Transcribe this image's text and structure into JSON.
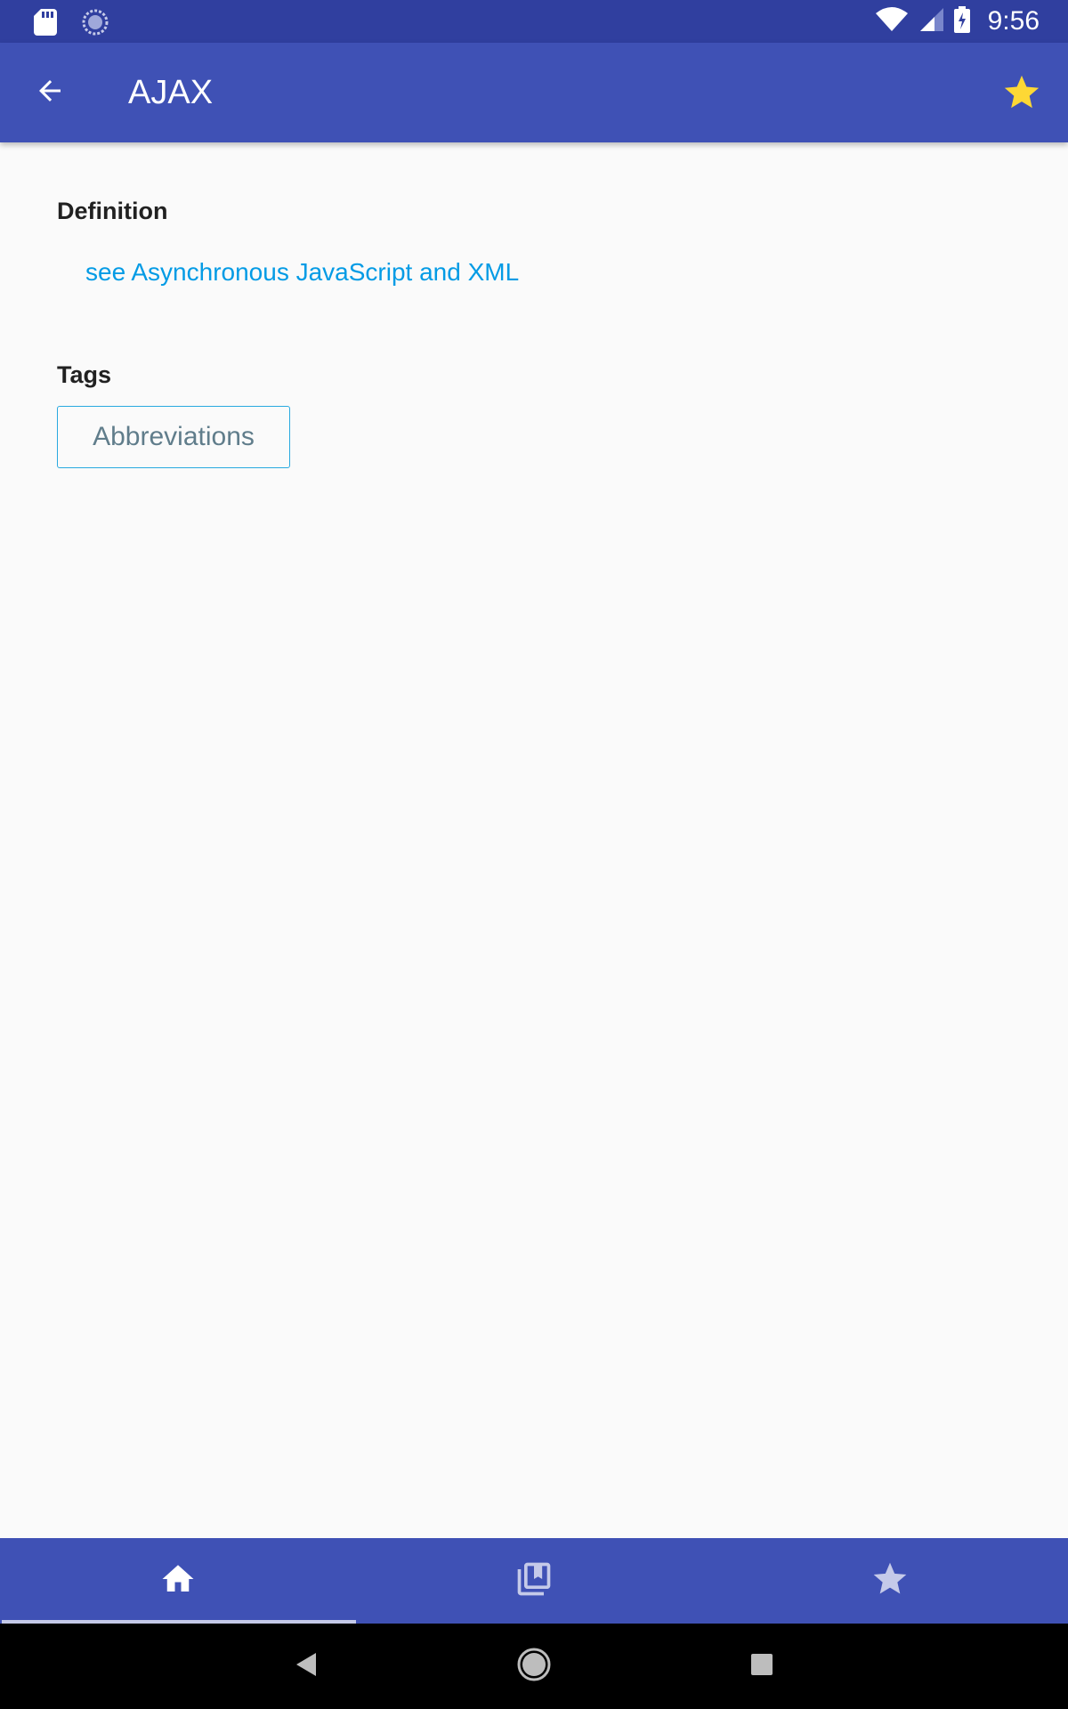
{
  "status_bar": {
    "time": "9:56",
    "icons": [
      "sd-card-icon",
      "sync-icon",
      "wifi-icon",
      "signal-icon",
      "battery-charging-icon"
    ]
  },
  "app_bar": {
    "title": "AJAX",
    "back_icon": "arrow-back-icon",
    "favorite_icon": "star-icon",
    "favorite_color": "#fdd835"
  },
  "content": {
    "definition_label": "Definition",
    "definition_text": "see Asynchronous JavaScript and XML",
    "tags_label": "Tags",
    "tags": [
      "Abbreviations"
    ]
  },
  "bottom_nav": {
    "tabs": [
      {
        "icon": "home-icon",
        "active": true
      },
      {
        "icon": "library-books-icon",
        "active": false
      },
      {
        "icon": "star-icon",
        "active": false
      }
    ]
  },
  "system_nav": {
    "buttons": [
      "back-triangle-icon",
      "home-circle-icon",
      "recents-square-icon"
    ]
  },
  "colors": {
    "status_bar": "#303f9f",
    "primary": "#3f51b5",
    "link": "#039be5",
    "chip_border": "#29a9e0",
    "chip_text": "#607d8b",
    "background": "#fafafa"
  }
}
